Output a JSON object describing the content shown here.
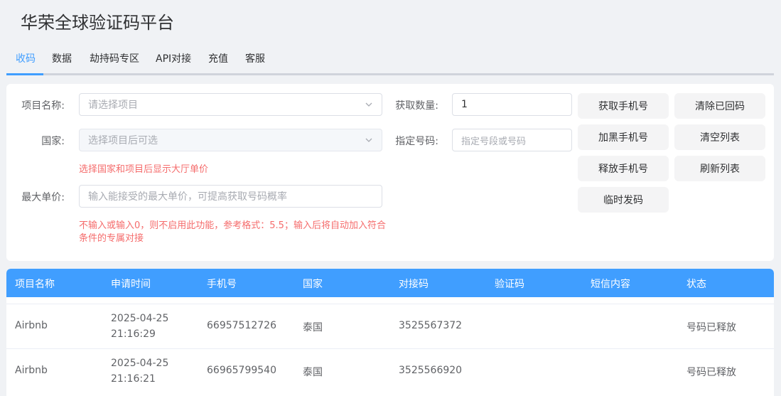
{
  "app": {
    "title": "华荣全球验证码平台"
  },
  "tabs": [
    {
      "label": "收码",
      "active": true
    },
    {
      "label": "数据"
    },
    {
      "label": "劫持码专区"
    },
    {
      "label": "API对接"
    },
    {
      "label": "充值"
    },
    {
      "label": "客服"
    }
  ],
  "form": {
    "project_label": "项目名称:",
    "project_placeholder": "请选择项目",
    "country_label": "国家:",
    "country_placeholder": "选择项目后可选",
    "country_hint": "选择国家和项目后显示大厅单价",
    "max_price_label": "最大单价:",
    "max_price_placeholder": "输入能接受的最大单价，可提高获取号码概率",
    "max_price_hint": "不输入或输入0，则不启用此功能，参考格式：5.5；输入后将自动加入符合条件的专属对接",
    "quantity_label": "获取数量:",
    "quantity_value": "1",
    "number_label": "指定号码:",
    "number_placeholder": "指定号段或号码"
  },
  "buttons": {
    "get_phone": "获取手机号",
    "clear_received": "清除已回码",
    "blacklist_phone": "加黑手机号",
    "clear_list": "清空列表",
    "release_phone": "释放手机号",
    "refresh_list": "刷新列表",
    "temp_send": "临时发码"
  },
  "table": {
    "headers": [
      "项目名称",
      "申请时间",
      "手机号",
      "国家",
      "对接码",
      "验证码",
      "短信内容",
      "状态"
    ],
    "rows": [
      {
        "project": "Airbnb",
        "date": "2025-04-25",
        "time": "21:16:29",
        "phone": "66957512726",
        "country": "泰国",
        "code": "3525567372",
        "verify": "",
        "sms": "",
        "status": "号码已释放"
      },
      {
        "project": "Airbnb",
        "date": "2025-04-25",
        "time": "21:16:21",
        "phone": "66965799540",
        "country": "泰国",
        "code": "3525566920",
        "verify": "",
        "sms": "",
        "status": "号码已释放"
      }
    ]
  }
}
